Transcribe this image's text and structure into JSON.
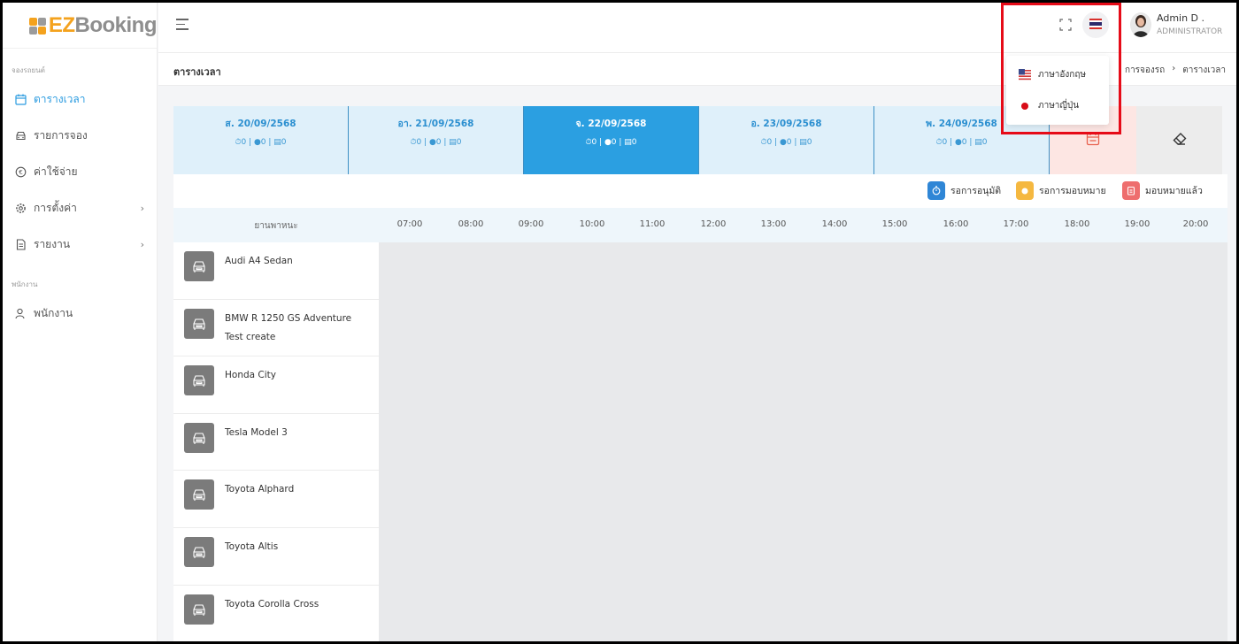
{
  "brand": {
    "ez": "EZ",
    "booking": "Booking"
  },
  "sidebar": {
    "section_booking": "จองรถยนต์",
    "items": [
      {
        "label": "ตารางเวลา",
        "icon": "calendar-icon",
        "active": true
      },
      {
        "label": "รายการจอง",
        "icon": "car-icon"
      },
      {
        "label": "ค่าใช้จ่าย",
        "icon": "coin-icon"
      },
      {
        "label": "การตั้งค่า",
        "icon": "gear-icon",
        "chevron": "›"
      },
      {
        "label": "รายงาน",
        "icon": "report-icon",
        "chevron": "›"
      }
    ],
    "section_staff": "พนักงาน",
    "staff_item": {
      "label": "พนักงาน",
      "icon": "user-icon"
    }
  },
  "header": {
    "user_name": "Admin D .",
    "user_role": "ADMINISTRATOR"
  },
  "subheader": {
    "title": "ตารางเวลา",
    "breadcrumb": [
      "การจองรถ",
      "›",
      "ตารางเวลา"
    ]
  },
  "days": [
    {
      "label": "ส. 20/09/2568",
      "stats": "⏱0 | ●0 | ▤0"
    },
    {
      "label": "อา. 21/09/2568",
      "stats": "⏱0 | ●0 | ▤0"
    },
    {
      "label": "จ. 22/09/2568",
      "stats": "⏱0 | ●0 | ▤0",
      "active": true
    },
    {
      "label": "อ. 23/09/2568",
      "stats": "⏱0 | ●0 | ▤0"
    },
    {
      "label": "พ. 24/09/2568",
      "stats": "⏱0 | ●0 | ▤0"
    }
  ],
  "legend": [
    {
      "label": "รอการอนุมัติ",
      "color": "#2f86d6"
    },
    {
      "label": "รอการมอบหมาย",
      "color": "#f5b840"
    },
    {
      "label": "มอบหมายแล้ว",
      "color": "#ee6e6e"
    }
  ],
  "timeline": {
    "vehicle_header": "ยานพาหนะ",
    "hours": [
      "07:00",
      "08:00",
      "09:00",
      "10:00",
      "11:00",
      "12:00",
      "13:00",
      "14:00",
      "15:00",
      "16:00",
      "17:00",
      "18:00",
      "19:00",
      "20:00"
    ]
  },
  "vehicles": [
    {
      "name": "Audi A4 Sedan"
    },
    {
      "name": "BMW R 1250 GS Adventure Test create"
    },
    {
      "name": "Honda City"
    },
    {
      "name": "Tesla Model 3"
    },
    {
      "name": "Toyota Alphard"
    },
    {
      "name": "Toyota Altis"
    },
    {
      "name": "Toyota Corolla Cross"
    }
  ],
  "language_menu": {
    "items": [
      {
        "label": "ภาษาอังกฤษ",
        "icon": "us-flag-icon"
      },
      {
        "label": "ภาษาญี่ปุ่น",
        "icon": "japan-flag-icon"
      }
    ]
  },
  "colors": {
    "accent": "#2b9fe1",
    "highlight": "#e60b18"
  }
}
